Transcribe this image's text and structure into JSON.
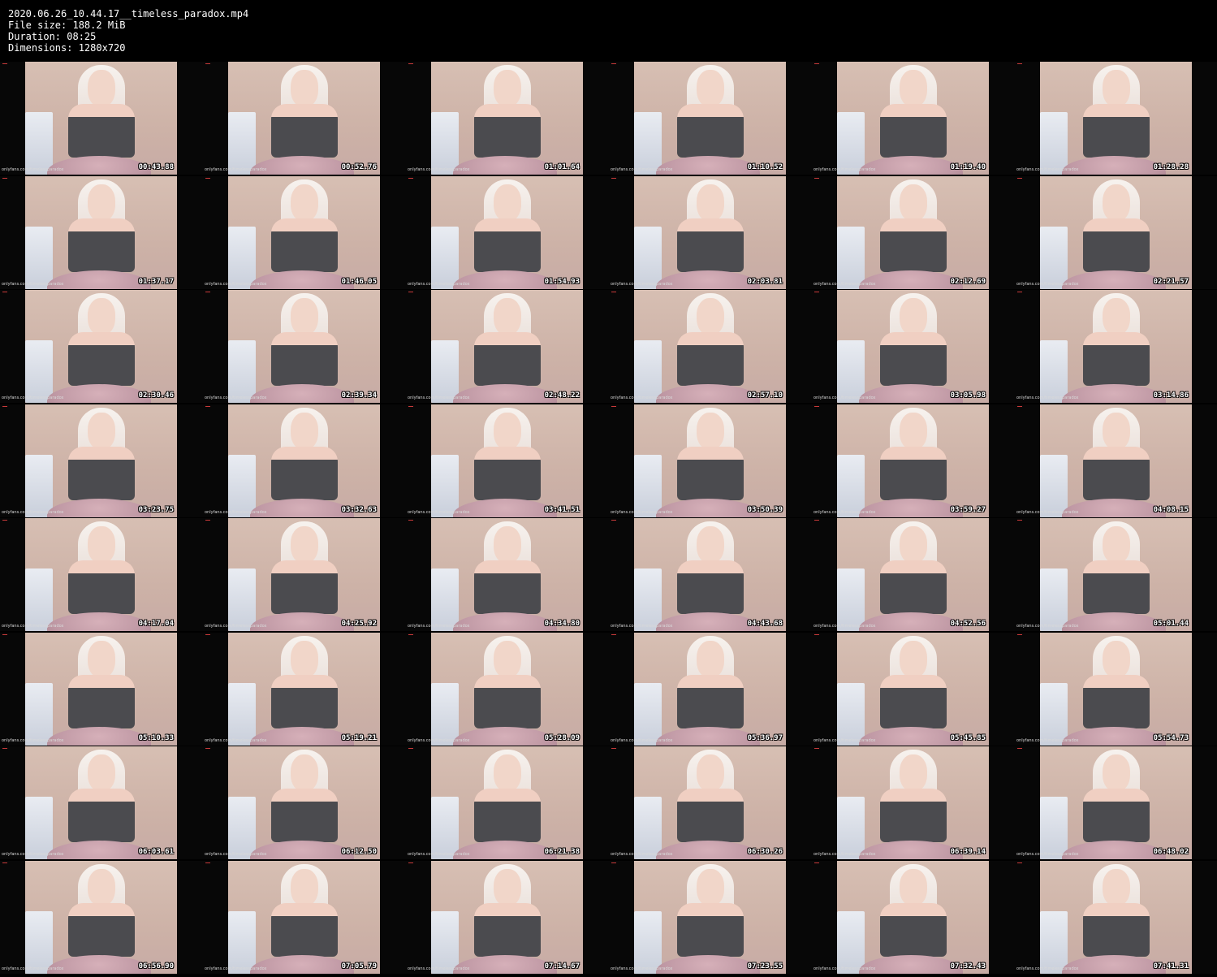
{
  "header": {
    "filename": "2020.06.26_10.44.17__timeless_paradox.mp4",
    "file_size": "File size: 188.2 MiB",
    "duration": "Duration: 08:25",
    "dimensions": "Dimensions: 1280x720"
  },
  "watermark": "onlyfans.com/timelessparadox",
  "thumbnails": [
    "00:43.88",
    "00:52.76",
    "01:01.64",
    "01:10.52",
    "01:19.40",
    "01:28.28",
    "01:37.17",
    "01:46.05",
    "01:54.93",
    "02:03.81",
    "02:12.69",
    "02:21.57",
    "02:30.46",
    "02:39.34",
    "02:48.22",
    "02:57.10",
    "03:05.98",
    "03:14.86",
    "03:23.75",
    "03:32.63",
    "03:41.51",
    "03:50.39",
    "03:59.27",
    "04:08.15",
    "04:17.04",
    "04:25.92",
    "04:34.80",
    "04:43.68",
    "04:52.56",
    "05:01.44",
    "05:10.33",
    "05:19.21",
    "05:28.09",
    "05:36.97",
    "05:45.85",
    "05:54.73",
    "06:03.61",
    "06:12.50",
    "06:21.38",
    "06:30.26",
    "06:39.14",
    "06:48.02",
    "06:56.90",
    "07:05.79",
    "07:14.67",
    "07:23.55",
    "07:32.43",
    "07:41.31"
  ]
}
